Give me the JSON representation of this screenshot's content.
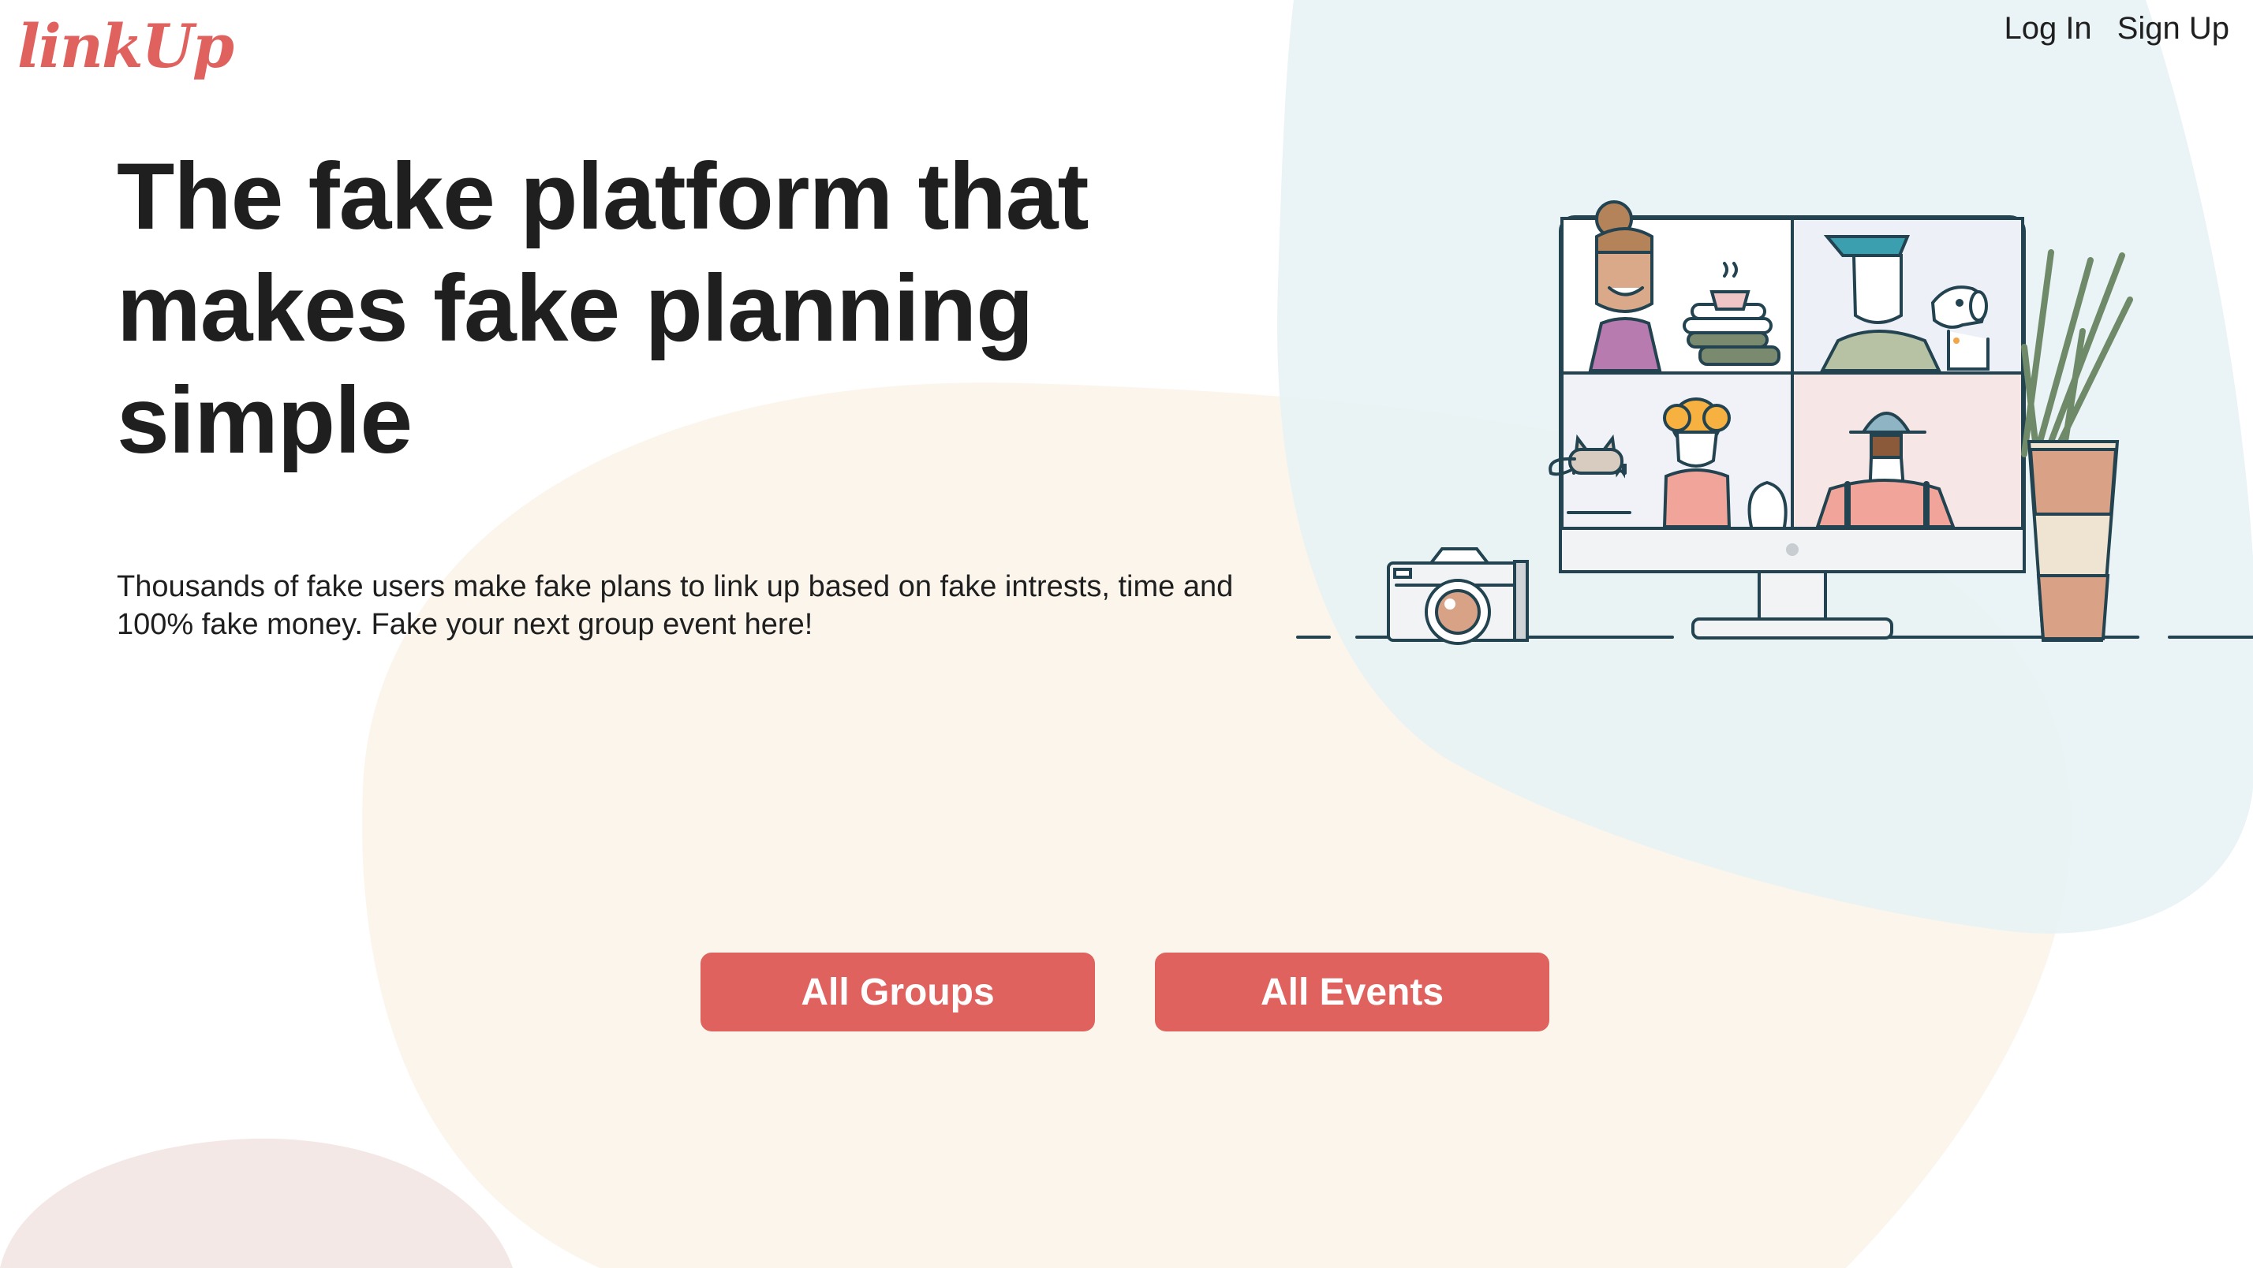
{
  "header": {
    "logo_text": "linkUp",
    "nav": {
      "login_label": "Log In",
      "signup_label": "Sign Up"
    }
  },
  "hero": {
    "headline": "The fake platform that makes fake planning simple",
    "subtitle": "Thousands of fake users make fake plans to link up based on fake intrests, time and 100% fake money. Fake your next group event here!"
  },
  "actions": {
    "groups_label": "All Groups",
    "events_label": "All Events"
  },
  "colors": {
    "brand": "#e0625f",
    "blob_blue": "#e8f2f4",
    "blob_cream": "#fbf5ec",
    "blob_pink": "#f3e8e6",
    "ink": "#22434f"
  },
  "illustration": {
    "icons": [
      "video-call-monitor-icon",
      "camera-icon",
      "plant-icon"
    ]
  }
}
